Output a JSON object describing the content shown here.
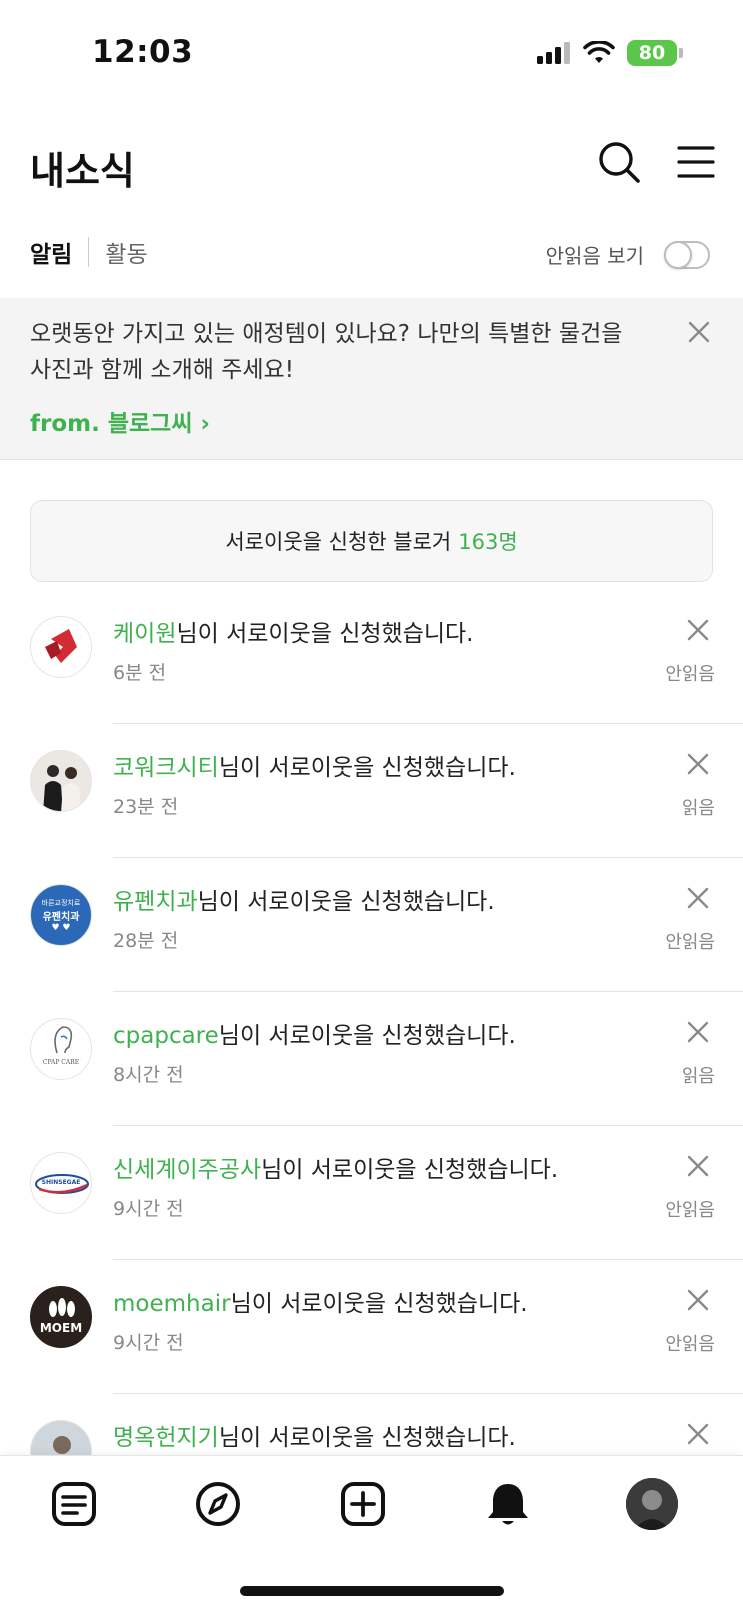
{
  "status_bar": {
    "time": "12:03",
    "battery": "80"
  },
  "header": {
    "title": "내소식"
  },
  "tabs": [
    {
      "label": "알림",
      "active": true
    },
    {
      "label": "활동",
      "active": false
    }
  ],
  "unread_filter": {
    "label": "안읽음 보기",
    "enabled": false
  },
  "banner": {
    "text": "오랫동안 가지고 있는 애정템이 있나요? 나만의 특별한 물건을 사진과 함께 소개해 주세요!",
    "from": "from. 블로그씨 ›"
  },
  "neighbor_requests": {
    "label": "서로이웃을 신청한 블로거",
    "count": "163명"
  },
  "notifications": [
    {
      "name": "케이원",
      "message": "님이 서로이웃을 신청했습니다.",
      "time": "6분 전",
      "status": "안읽음",
      "avatar_icon": "red-ribbon-logo-icon"
    },
    {
      "name": "코워크시티",
      "message": "님이 서로이웃을 신청했습니다.",
      "time": "23분 전",
      "status": "읽음",
      "avatar_icon": "couple-photo-icon"
    },
    {
      "name": "유펜치과",
      "message": "님이 서로이웃을 신청했습니다.",
      "time": "28분 전",
      "status": "안읽음",
      "avatar_icon": "dental-logo-icon",
      "avatar_text_top": "바른교정치료",
      "avatar_text_main": "유펜치과"
    },
    {
      "name": "cpapcare",
      "message": "님이 서로이웃을 신청했습니다.",
      "time": "8시간 전",
      "status": "읽음",
      "avatar_icon": "cpap-logo-icon",
      "avatar_text": "CPAP CARE"
    },
    {
      "name": "신세계이주공사",
      "message": "님이 서로이웃을 신청했습니다.",
      "time": "9시간 전",
      "status": "안읽음",
      "avatar_icon": "shinsegae-logo-icon",
      "avatar_text": "SHINSEGAE"
    },
    {
      "name": "moemhair",
      "message": "님이 서로이웃을 신청했습니다.",
      "time": "9시간 전",
      "status": "안읽음",
      "avatar_icon": "moem-logo-icon",
      "avatar_text": "MOEM"
    },
    {
      "name": "명옥헌지기",
      "message": "님이 서로이웃을 신청했습니다.",
      "time": "",
      "status": "",
      "avatar_icon": "photo-avatar-icon"
    }
  ],
  "colors": {
    "accent": "#3fb24f",
    "text": "#222222",
    "muted": "#888888"
  },
  "bottom_nav": [
    {
      "icon": "feed-icon"
    },
    {
      "icon": "discover-compass-icon"
    },
    {
      "icon": "write-plus-icon"
    },
    {
      "icon": "notification-bell-icon",
      "active": true
    },
    {
      "icon": "profile-avatar-icon"
    }
  ]
}
